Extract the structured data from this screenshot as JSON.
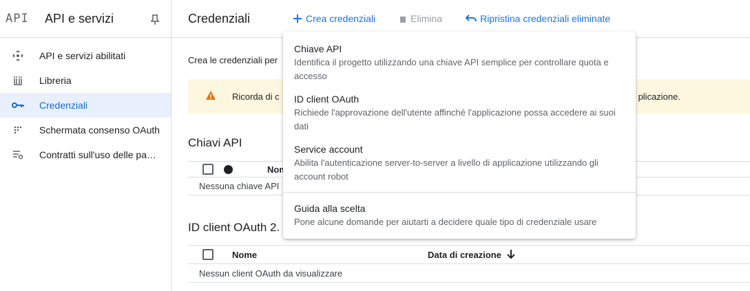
{
  "sidebar": {
    "logo": "API",
    "title": "API e servizi",
    "items": [
      {
        "label": "API e servizi abilitati",
        "icon": "diamond-arrows-icon"
      },
      {
        "label": "Libreria",
        "icon": "library-icon"
      },
      {
        "label": "Credenziali",
        "icon": "key-icon",
        "active": true
      },
      {
        "label": "Schermata consenso OAuth",
        "icon": "consent-icon"
      },
      {
        "label": "Contratti sull'uso delle pagine",
        "icon": "settings-list-icon"
      }
    ]
  },
  "toolbar": {
    "title": "Credenziali",
    "create_label": "Crea credenziali",
    "delete_label": "Elimina",
    "restore_label": "Ripristina credenziali eliminate"
  },
  "main": {
    "intro_text": "Crea le credenziali per",
    "banner_start": "Ricorda di c",
    "banner_end": "plicazione."
  },
  "api_keys": {
    "title": "Chiavi API",
    "col_name": "Nom",
    "empty": "Nessuna chiave API"
  },
  "oauth": {
    "title": "ID client OAuth 2.",
    "col_name": "Nome",
    "col_date": "Data di creazione",
    "empty": "Nessun client OAuth da visualizzare"
  },
  "menu": {
    "items": [
      {
        "title": "Chiave API",
        "desc": "Identifica il progetto utilizzando una chiave API semplice per controllare quota e accesso"
      },
      {
        "title": "ID client OAuth",
        "desc": "Richiede l'approvazione dell'utente affinché l'applicazione possa accedere ai suoi dati"
      },
      {
        "title": "Service account",
        "desc": "Abilita l'autenticazione server-to-server a livello di applicazione utilizzando gli account robot"
      }
    ],
    "help": {
      "title": "Guida alla scelta",
      "desc": "Pone alcune domande per aiutarti a decidere quale tipo di credenziale usare"
    }
  },
  "colors": {
    "accent": "#1a73e8",
    "active_bg": "#e8f0fe",
    "warning": "#e37400",
    "banner_bg": "#fef7e0"
  }
}
